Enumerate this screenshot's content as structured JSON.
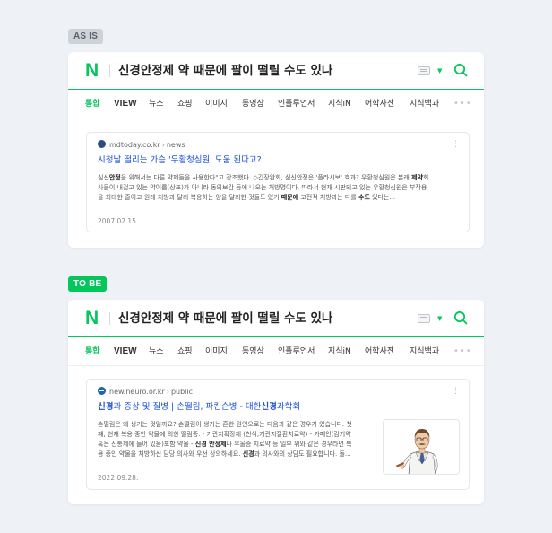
{
  "labels": {
    "asis": "AS IS",
    "tobe": "TO BE"
  },
  "colors": {
    "brand": "#03c75a",
    "link": "#1d4ed8",
    "tag_asis_bg": "#cfd3d8"
  },
  "search": {
    "logo": "N",
    "query": "신경안정제 약 때문에 팔이 떨릴 수도 있나",
    "keyboard_icon": "keyboard-icon",
    "caret_icon": "caret-down-icon",
    "search_icon": "search-icon"
  },
  "tabs": [
    "통합",
    "VIEW",
    "뉴스",
    "쇼핑",
    "이미지",
    "동영상",
    "인플루언서",
    "지식iN",
    "어학사전",
    "지식백과"
  ],
  "more": "•••",
  "kebab": "⋮",
  "asis": {
    "site": "mdtoday.co.kr",
    "section": "news",
    "title": "시청날 떨리는 가슴 '우황청심원' 도움 된다고?",
    "desc": [
      {
        "pre": "심신",
        "b": "안정",
        "post": "을 위해서는 다른 약제들을 사용한다\"고 강조했다. ◇긴장완화, 심신안정은 '플라시보' 효과? 우황청심원은 본래 ",
        "b2": "제약",
        "post2": "회"
      },
      {
        "pre": "사들이 내걸고 있는 약이름(상표)가 아니라 동의보감 등에 나오는 처방명이다. 따라서 현재 시판되고 있는 우황청심원은 부작용",
        "b": "",
        "post": "",
        "b2": "",
        "post2": ""
      },
      {
        "pre": "을 최대한 줄이고 원래 처방과 달리 복용하는 양을 달리한 것들도 있기 ",
        "b": "때문에",
        "post": " 고전적 처방과는 다를 ",
        "b2": "수도",
        "post2": " 있다는..."
      }
    ],
    "date": "2007.02.15."
  },
  "tobe": {
    "site": "new.neuro.or.kr",
    "section": "public",
    "title_pre": "",
    "title_b1": "신경",
    "title_mid": "과 증상 및 질병 | 손떨림, 파킨슨병 - 대한",
    "title_b2": "신경",
    "title_post": "과학회",
    "desc": [
      {
        "pre": "손떨림은 왜 생기는 것일까요? 손떨림이 생기는 흔한 원인으로는 다음과 같은 경우가 있습니다. 첫",
        "b": "",
        "post": "",
        "b2": "",
        "post2": ""
      },
      {
        "pre": "째, 현재 복용 중인 약물에 의한 떨림증. - 기관지확장제 (천식,기관지질환치료약) - 카페인(감기약",
        "b": "",
        "post": "",
        "b2": "",
        "post2": ""
      },
      {
        "pre": "혹은 진통제에 들어 있음)포함 약물 - ",
        "b": "신경 안정제",
        "post": "나 우울증 치료약 등 일부 위와 같은 경우라면 복",
        "b2": "",
        "post2": ""
      },
      {
        "pre": "용 중인 약물을 처방하신 담당 의사와 우선 상의하세요. ",
        "b": "신경",
        "post": "과 의사와의 상담도 필요합니다. 돌...",
        "b2": "",
        "post2": ""
      }
    ],
    "date": "2022.09.28.",
    "thumbnail": "doctor-illustration"
  }
}
